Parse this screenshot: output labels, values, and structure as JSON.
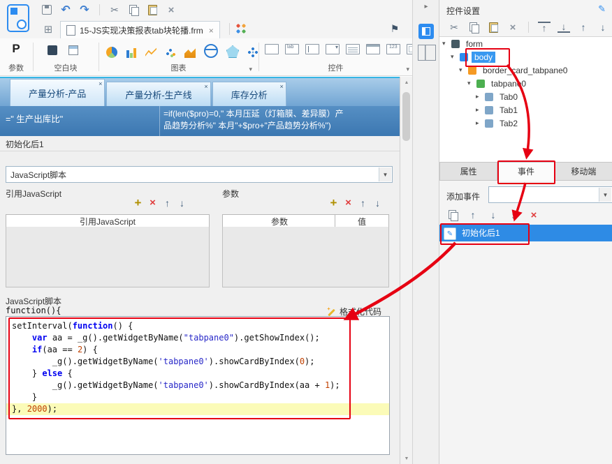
{
  "colors": {
    "accent": "#2d8cf0",
    "annotation_red": "#e60012",
    "selection_blue": "#3898f0",
    "code_keyword": "#0000f0",
    "code_string": "#2828c8",
    "code_number": "#c04000"
  },
  "icon_glyphs": {
    "undo": "↶",
    "redo": "↷",
    "cut": "✂",
    "delete": "×",
    "flag": "⚑",
    "grid-view": "⊞",
    "add": "+",
    "remove": "×",
    "move-up": "↑",
    "move-down": "↓",
    "move-top": "↑",
    "move-bottom": "↓",
    "move": "↕",
    "delete-red": "×"
  },
  "toolbars": {
    "main": [
      "save",
      "undo",
      "redo",
      "sep",
      "cut",
      "copy",
      "paste",
      "delete"
    ],
    "rpanel": [
      "cut",
      "copy",
      "paste",
      "delete",
      "sep",
      "move-top",
      "move-bottom",
      "move-up",
      "move-down"
    ],
    "listops": [
      "add",
      "remove",
      "move-up",
      "move-down"
    ],
    "eventops": [
      "copy-event",
      "move-up",
      "move-down",
      "move",
      "delete-red"
    ]
  },
  "doc_tab": {
    "label": "15-JS实现决策报表tab块轮播.frm",
    "close": "×"
  },
  "palette": {
    "param": {
      "label": "参数",
      "icon_text": "P"
    },
    "blank": {
      "label": "空白块",
      "icons": [
        "blank-block",
        "report-block"
      ]
    },
    "chart": {
      "label": "图表",
      "icons": [
        "pie-chart",
        "bar-chart",
        "line-chart",
        "scatter-chart",
        "area-chart",
        "map-chart",
        "radar-chart",
        "more-chart"
      ],
      "chevron": "▾"
    },
    "widget": {
      "label": "控件",
      "icons": [
        "rect-widget",
        "label-widget",
        "textfield-widget",
        "combobox-widget",
        "textarea-widget",
        "datefield-widget",
        "numberfield-widget",
        "panel-widget"
      ],
      "chevron": "▾"
    }
  },
  "canvas": {
    "tabs": [
      "产量分析-产品",
      "产量分析-生产线",
      "库存分析"
    ],
    "cell_left": "=\" 生产出库比\"",
    "formula_line1": "=if(len($pro)=0,\" 本月压延（灯箱膜、差异膜）产",
    "formula_line2": "品趋势分析%\" 本月\"+$pro+\"产品趋势分析%\")"
  },
  "event_dialog": {
    "title": "初始化后1",
    "type_select": "JavaScript脚本",
    "ref_js": {
      "label": "引用JavaScript",
      "header": "引用JavaScript"
    },
    "params": {
      "label": "参数",
      "headers": [
        "参数",
        "值"
      ]
    },
    "js_label": "JavaScript脚本",
    "fn_prefix": "function(){",
    "format_btn": "格式化代码",
    "code_lines": [
      {
        "segs": [
          {
            "t": "setInterval(",
            "c": "pl"
          },
          {
            "t": "function",
            "c": "kw"
          },
          {
            "t": "() {",
            "c": "pl"
          }
        ]
      },
      {
        "segs": [
          {
            "t": "    ",
            "c": "pl"
          },
          {
            "t": "var",
            "c": "kw"
          },
          {
            "t": " aa = _g().getWidgetByName(",
            "c": "pl"
          },
          {
            "t": "\"tabpane0\"",
            "c": "str"
          },
          {
            "t": ").getShowIndex();",
            "c": "pl"
          }
        ]
      },
      {
        "segs": [
          {
            "t": "    ",
            "c": "pl"
          },
          {
            "t": "if",
            "c": "kw"
          },
          {
            "t": "(aa == ",
            "c": "pl"
          },
          {
            "t": "2",
            "c": "num"
          },
          {
            "t": ") {",
            "c": "pl"
          }
        ]
      },
      {
        "segs": [
          {
            "t": "        _g().getWidgetByName(",
            "c": "pl"
          },
          {
            "t": "'tabpane0'",
            "c": "str"
          },
          {
            "t": ").showCardByIndex(",
            "c": "pl"
          },
          {
            "t": "0",
            "c": "num"
          },
          {
            "t": ");",
            "c": "pl"
          }
        ]
      },
      {
        "segs": [
          {
            "t": "    } ",
            "c": "pl"
          },
          {
            "t": "else",
            "c": "kw"
          },
          {
            "t": " {",
            "c": "pl"
          }
        ]
      },
      {
        "segs": [
          {
            "t": "        _g().getWidgetByName(",
            "c": "pl"
          },
          {
            "t": "'tabpane0'",
            "c": "str"
          },
          {
            "t": ").showCardByIndex(aa + ",
            "c": "pl"
          },
          {
            "t": "1",
            "c": "num"
          },
          {
            "t": ");",
            "c": "pl"
          }
        ]
      },
      {
        "segs": [
          {
            "t": "    }",
            "c": "pl"
          }
        ]
      },
      {
        "segs": [
          {
            "t": "}, ",
            "c": "pl"
          },
          {
            "t": "2000",
            "c": "num"
          },
          {
            "t": ");",
            "c": "pl"
          }
        ],
        "highlight": true
      }
    ]
  },
  "right_panel": {
    "title": "控件设置",
    "tree": [
      {
        "label": "form",
        "depth": 0,
        "expanded": true,
        "icon": "form"
      },
      {
        "label": "body",
        "depth": 1,
        "expanded": true,
        "icon": "body",
        "selected": true
      },
      {
        "label": "border_card_tabpane0",
        "depth": 2,
        "expanded": true,
        "icon": "card"
      },
      {
        "label": "tabpane0",
        "depth": 3,
        "expanded": true,
        "icon": "tabpane"
      },
      {
        "label": "Tab0",
        "depth": 4,
        "expanded": false,
        "icon": "tab"
      },
      {
        "label": "Tab1",
        "depth": 4,
        "expanded": false,
        "icon": "tab"
      },
      {
        "label": "Tab2",
        "depth": 4,
        "expanded": false,
        "icon": "tab"
      }
    ],
    "tabs": [
      "属性",
      "事件",
      "移动端"
    ],
    "active_tab": "事件",
    "add_event_label": "添加事件",
    "event_item": "初始化后1"
  }
}
